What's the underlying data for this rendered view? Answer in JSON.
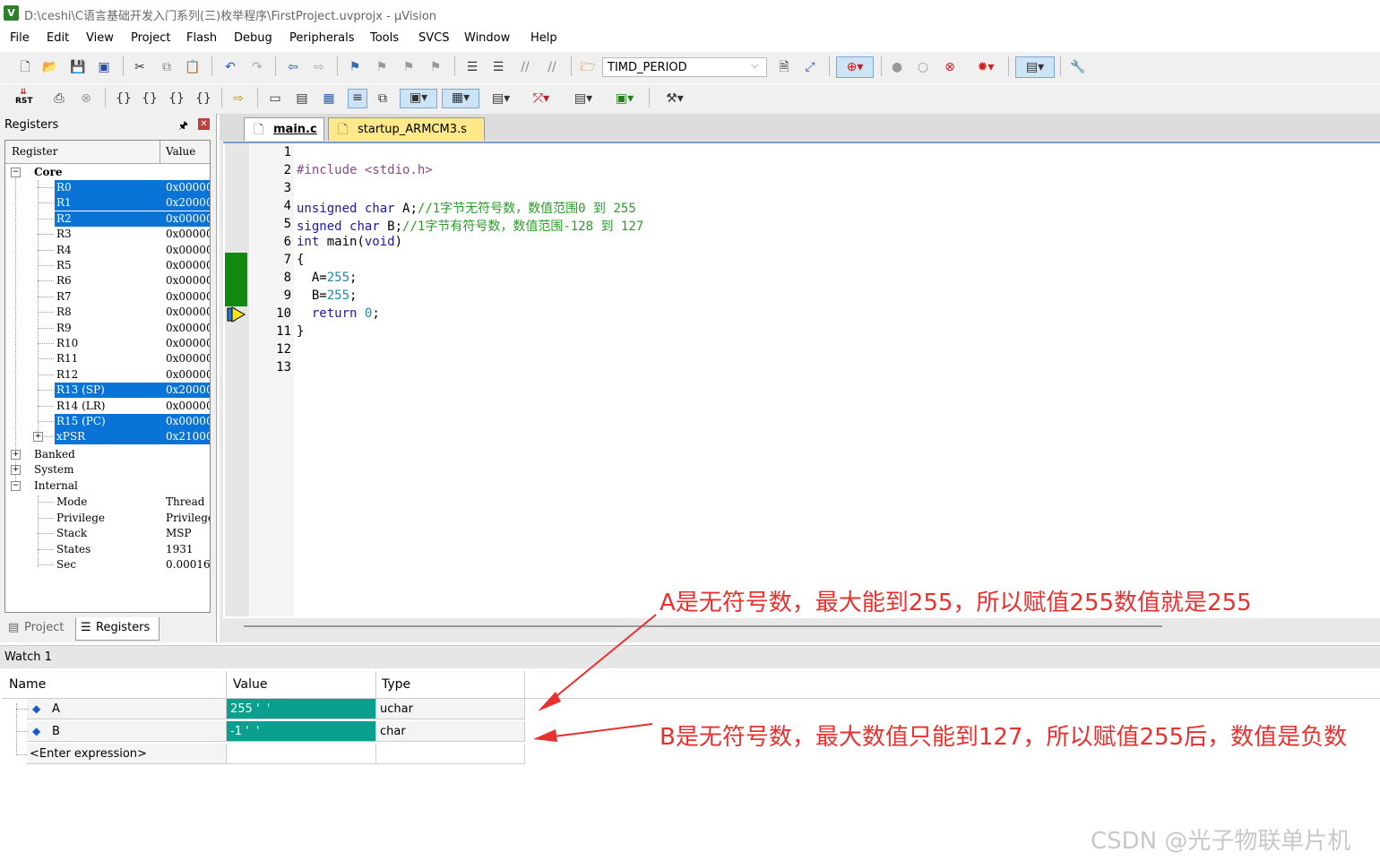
{
  "window": {
    "title": "D:\\ceshi\\C语言基础开发入门系列(三)枚举程序\\FirstProject.uvprojx - µVision",
    "app_icon": "V"
  },
  "menu": [
    "File",
    "Edit",
    "View",
    "Project",
    "Flash",
    "Debug",
    "Peripherals",
    "Tools",
    "SVCS",
    "Window",
    "Help"
  ],
  "toolbar": {
    "target_name": "TIMD_PERIOD",
    "rst_label": "RST"
  },
  "registers_panel": {
    "title": "Registers",
    "col_register": "Register",
    "col_value": "Value",
    "core_label": "Core",
    "core_registers": [
      {
        "name": "R0",
        "value": "0x00000",
        "selected": true
      },
      {
        "name": "R1",
        "value": "0x20000",
        "selected": true
      },
      {
        "name": "R2",
        "value": "0x00000",
        "selected": true
      },
      {
        "name": "R3",
        "value": "0x00000",
        "selected": false
      },
      {
        "name": "R4",
        "value": "0x00000",
        "selected": false
      },
      {
        "name": "R5",
        "value": "0x00000",
        "selected": false
      },
      {
        "name": "R6",
        "value": "0x00000",
        "selected": false
      },
      {
        "name": "R7",
        "value": "0x00000",
        "selected": false
      },
      {
        "name": "R8",
        "value": "0x00000",
        "selected": false
      },
      {
        "name": "R9",
        "value": "0x00000",
        "selected": false
      },
      {
        "name": "R10",
        "value": "0x00000",
        "selected": false
      },
      {
        "name": "R11",
        "value": "0x00000",
        "selected": false
      },
      {
        "name": "R12",
        "value": "0x00000",
        "selected": false
      },
      {
        "name": "R13 (SP)",
        "value": "0x20000",
        "selected": true
      },
      {
        "name": "R14 (LR)",
        "value": "0x00000",
        "selected": false
      },
      {
        "name": "R15 (PC)",
        "value": "0x00000",
        "selected": true
      },
      {
        "name": "xPSR",
        "value": "0x21000",
        "selected": true
      }
    ],
    "groups": [
      "Banked",
      "System",
      "Internal"
    ],
    "internal_items": [
      {
        "name": "Mode",
        "value": "Thread"
      },
      {
        "name": "Privilege",
        "value": "Privileged"
      },
      {
        "name": "Stack",
        "value": "MSP"
      },
      {
        "name": "States",
        "value": "1931"
      },
      {
        "name": "Sec",
        "value": "0.00016"
      }
    ],
    "tabs": [
      "Project",
      "Registers"
    ]
  },
  "editor": {
    "tabs": [
      "main.c",
      "startup_ARMCM3.s"
    ],
    "active_tab": "main.c",
    "line_numbers": [
      "1",
      "2",
      "3",
      "4",
      "5",
      "6",
      "7",
      "8",
      "9",
      "10",
      "11",
      "12",
      "13"
    ],
    "lines": [
      "",
      "#include <stdio.h>",
      "",
      "unsigned char A;//1字节无符号数，数值范围0 到 255",
      "signed char B;//1字节有符号数，数值范围-128 到 127",
      "int main(void)",
      "{",
      "  A=255;",
      "  B=255;",
      "  return 0;",
      "}",
      "",
      ""
    ]
  },
  "watch": {
    "title": "Watch 1",
    "col_name": "Name",
    "col_value": "Value",
    "col_type": "Type",
    "rows": [
      {
        "name": "A",
        "value": "255 '  '",
        "type": "uchar"
      },
      {
        "name": "B",
        "value": "-1 '  '",
        "type": "char"
      }
    ],
    "enter_expression": "<Enter expression>"
  },
  "annotations": {
    "a_note": "A是无符号数，最大能到255，所以赋值255数值就是255",
    "b_note": "B是无符号数，最大数值只能到127，所以赋值255后，数值是负数",
    "arrow_color": "#e8302f"
  },
  "watermark": "CSDN @光子物联单片机"
}
